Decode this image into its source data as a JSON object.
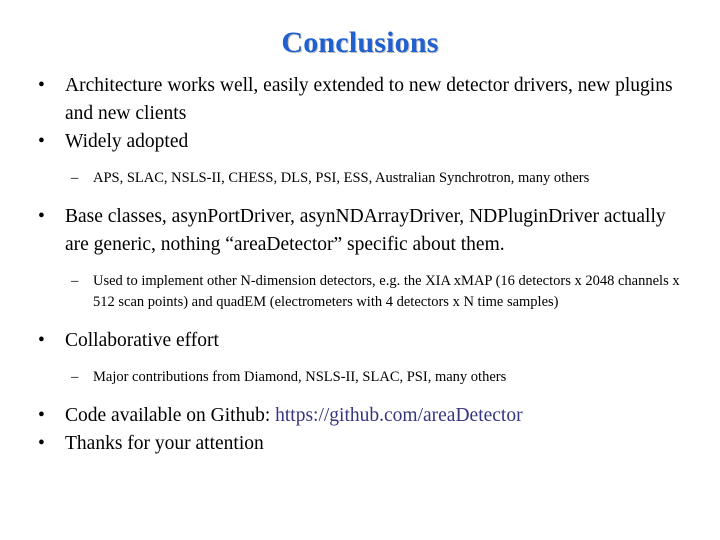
{
  "slide": {
    "title": "Conclusions",
    "title_color": "#2060cf",
    "background_color": "#ffffff",
    "text_color": "#000000",
    "link_color": "#35357f",
    "bullet_marker_level1": "•",
    "bullet_marker_level2": "–",
    "blocks": [
      {
        "level": 1,
        "text": "Architecture works well, easily extended to new detector drivers, new plugins and new clients"
      },
      {
        "level": 1,
        "text": "Widely adopted"
      },
      {
        "level": 2,
        "text": "APS, SLAC, NSLS-II, CHESS, DLS, PSI, ESS, Australian Synchrotron, many others"
      },
      {
        "level": 1,
        "text": "Base classes, asynPortDriver, asynNDArrayDriver, NDPluginDriver actually are generic, nothing “areaDetector” specific about them."
      },
      {
        "level": 2,
        "text": "Used to implement other N-dimension detectors, e.g. the XIA xMAP (16 detectors x 2048 channels x 512 scan points) and quadEM (electrometers with 4 detectors x N time samples)"
      },
      {
        "level": 1,
        "text": "Collaborative effort"
      },
      {
        "level": 2,
        "text": "Major contributions from Diamond, NSLS-II, SLAC, PSI, many others"
      },
      {
        "level": 1,
        "text_prefix": "Code available on Github: ",
        "link_text": "https://github.com/areaDetector"
      },
      {
        "level": 1,
        "text": "Thanks for your attention"
      }
    ]
  }
}
